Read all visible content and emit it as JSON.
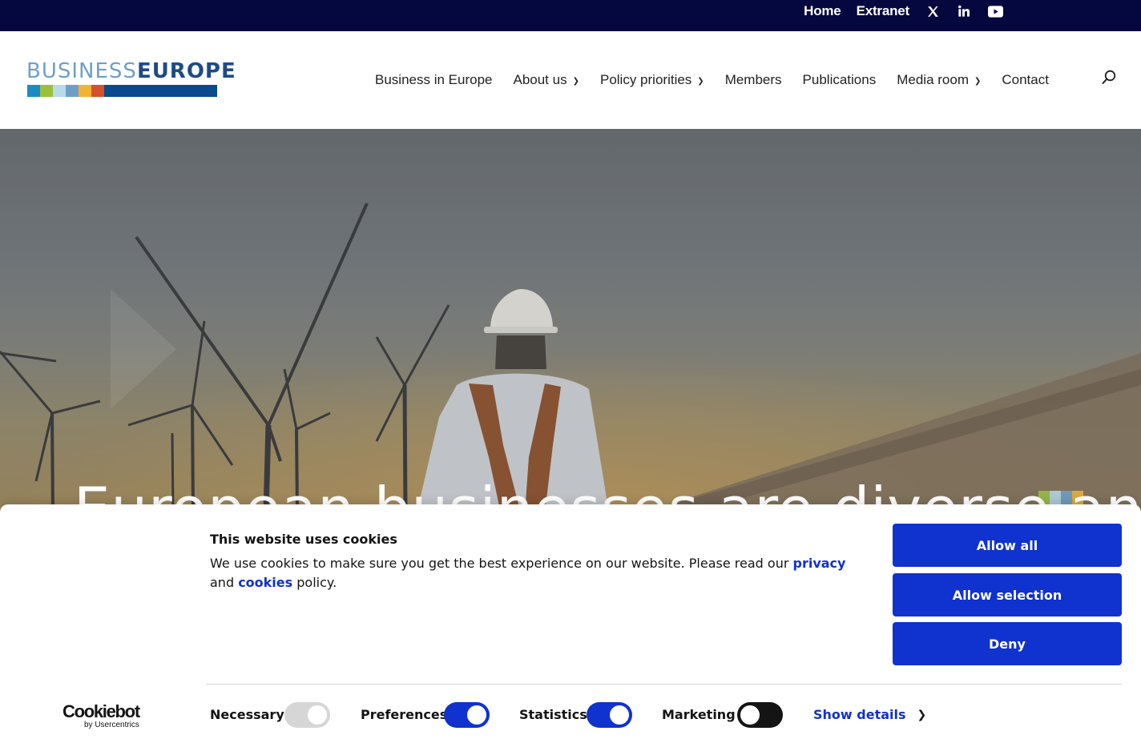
{
  "topbar": {
    "home": "Home",
    "extranet": "Extranet",
    "icons": [
      "x-twitter-icon",
      "linkedin-icon",
      "youtube-icon"
    ]
  },
  "logo": {
    "part1": "BUSINESS",
    "part2": "EUROPE",
    "colors": [
      "#1b8bc6",
      "#9bc13b",
      "#b8dbe9",
      "#6f9fc9",
      "#f2b233",
      "#d7502b"
    ]
  },
  "nav": {
    "items": [
      {
        "label": "Business in Europe",
        "dropdown": false
      },
      {
        "label": "About us",
        "dropdown": true
      },
      {
        "label": "Policy priorities",
        "dropdown": true
      },
      {
        "label": "Members",
        "dropdown": false
      },
      {
        "label": "Publications",
        "dropdown": false
      },
      {
        "label": "Media room",
        "dropdown": true
      },
      {
        "label": "Contact",
        "dropdown": false
      }
    ]
  },
  "hero": {
    "title": "European businesses are diverse and"
  },
  "cookie": {
    "title": "This website uses cookies",
    "text_before": "We use cookies to make sure you get the best experience on our website. Please read our ",
    "privacy": "privacy",
    "text_and": " and ",
    "cookies": "cookies",
    "text_after": " policy.",
    "allow_all": "Allow all",
    "allow_selection": "Allow selection",
    "deny": "Deny",
    "brand": "Cookiebot",
    "brand_sub": "by Usercentrics",
    "toggles": [
      {
        "label": "Necessary",
        "state": "disabled-on"
      },
      {
        "label": "Preferences",
        "state": "on"
      },
      {
        "label": "Statistics",
        "state": "on"
      },
      {
        "label": "Marketing",
        "state": "off"
      }
    ],
    "show_details": "Show details"
  },
  "colors": {
    "topbar": "#05083e",
    "accent": "#1032cf"
  }
}
